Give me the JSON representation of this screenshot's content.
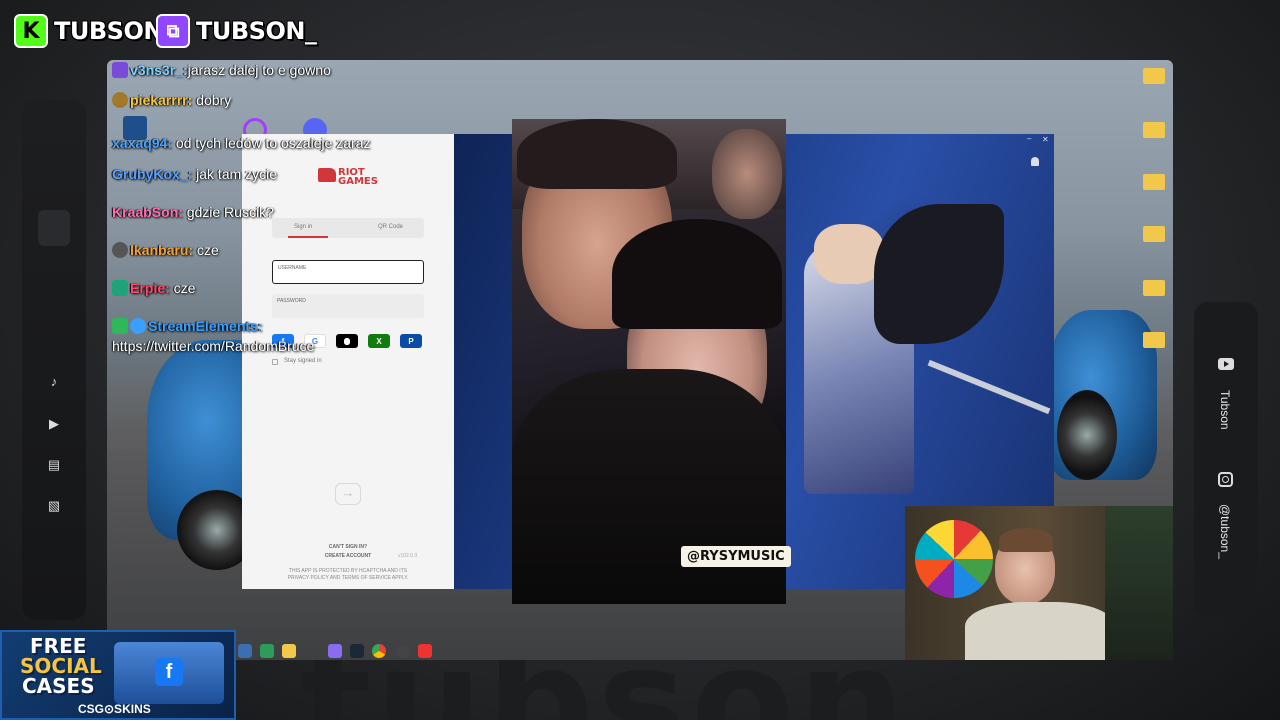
{
  "overlay": {
    "watermark": "tubson",
    "kick": {
      "glyph": "K",
      "handle": "TUBSON",
      "color": "#53fc18"
    },
    "twitch": {
      "glyph": "⧉",
      "handle": "TUBSON_",
      "color": "#9146ff"
    },
    "right_rail": {
      "youtube_handle": "Tubson",
      "instagram_handle": "@tubson_"
    },
    "left_rail_icons": [
      "music-icon",
      "video-icon",
      "calendar-icon",
      "image-icon"
    ]
  },
  "riot_client": {
    "logo_line1": "RIOT",
    "logo_line2": "GAMES",
    "tabs": {
      "sign_in": "Sign in",
      "qr_code": "QR Code"
    },
    "username_label": "USERNAME",
    "password_label": "PASSWORD",
    "stay_signed_in": "Stay signed in",
    "cant_sign_in": "CAN'T SIGN IN?",
    "create_account": "CREATE ACCOUNT",
    "version": "v102.0.3",
    "footer_line1": "THIS APP IS PROTECTED BY HCAPTCHA AND ITS",
    "footer_line2": "PRIVACY POLICY AND TERMS OF SERVICE APPLY.",
    "submit_arrow": "→",
    "window_controls": {
      "minimize": "–",
      "close": "✕"
    },
    "social_buttons": [
      {
        "name": "facebook",
        "glyph": "f",
        "color": "#1877f2"
      },
      {
        "name": "google",
        "glyph": "G",
        "color": "#ffffff"
      },
      {
        "name": "apple",
        "glyph": "",
        "color": "#000000"
      },
      {
        "name": "xbox",
        "glyph": "X",
        "color": "#107c10"
      },
      {
        "name": "playstation",
        "glyph": "P",
        "color": "#0a4ba8"
      }
    ]
  },
  "video": {
    "music_tag": "@RYSYMUSIC"
  },
  "chat": [
    {
      "user": "v3ns3r_:",
      "message": "jarasz dalej to e gowno",
      "color": "#7fd0ff"
    },
    {
      "user": "piekarrrr:",
      "message": "dobry",
      "color": "#f5c542"
    },
    {
      "user": "xaxaq94:",
      "message": "od tych ledów to oszaleje zaraz",
      "color": "#4aa3ff"
    },
    {
      "user": "GrubyKox_:",
      "message": "jak tam zycie",
      "color": "#5aa0ff"
    },
    {
      "user": "KraabSon:",
      "message": "gdzie Ruscik?",
      "color": "#ff6fb0"
    },
    {
      "user": "Ikanbaru:",
      "message": "cze",
      "color": "#f0a23a"
    },
    {
      "user": "Erpie:",
      "message": "cze",
      "color": "#ff4a6a"
    },
    {
      "user": "StreamElements:",
      "message": "https://twitter.com/RandomBruce",
      "color": "#3aa0ff"
    }
  ],
  "ad": {
    "line1": "FREE",
    "line2": "SOCIAL",
    "line3": "CASES",
    "brand": "CSG⊙SKINS"
  }
}
